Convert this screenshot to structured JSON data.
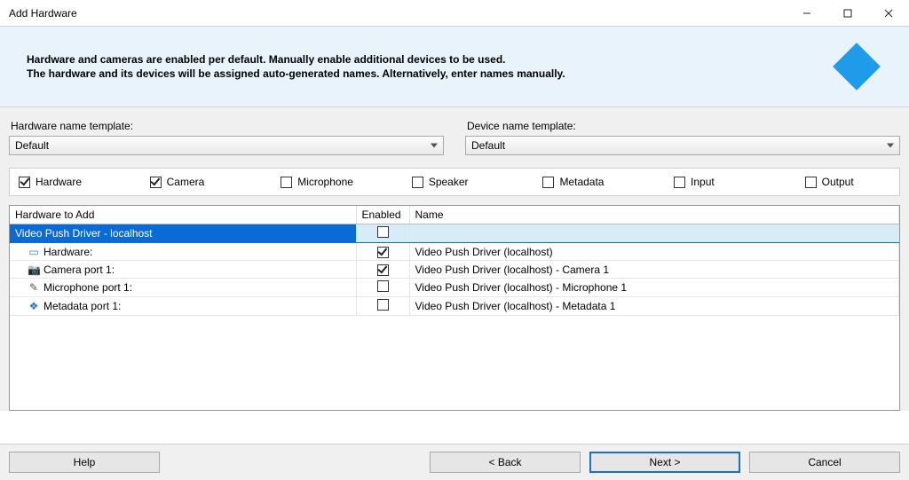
{
  "window": {
    "title": "Add Hardware"
  },
  "banner": {
    "line1": "Hardware and cameras are enabled per default. Manually enable additional devices to be used.",
    "line2": "The hardware and its devices will be assigned auto-generated names. Alternatively, enter names manually."
  },
  "templates": {
    "hardware_label": "Hardware name template:",
    "hardware_value": "Default",
    "device_label": "Device name template:",
    "device_value": "Default"
  },
  "filters": [
    {
      "label": "Hardware",
      "checked": true
    },
    {
      "label": "Camera",
      "checked": true
    },
    {
      "label": "Microphone",
      "checked": false
    },
    {
      "label": "Speaker",
      "checked": false
    },
    {
      "label": "Metadata",
      "checked": false
    },
    {
      "label": "Input",
      "checked": false
    },
    {
      "label": "Output",
      "checked": false
    }
  ],
  "table": {
    "headers": {
      "col1": "Hardware to Add",
      "col2": "Enabled",
      "col3": "Name"
    },
    "group_label": "Video Push Driver - localhost",
    "rows": [
      {
        "icon": "hw",
        "label": "Hardware:",
        "enabled": true,
        "name": "Video Push Driver (localhost)"
      },
      {
        "icon": "cam",
        "label": "Camera port 1:",
        "enabled": true,
        "name": "Video Push Driver (localhost) - Camera 1"
      },
      {
        "icon": "mic",
        "label": "Microphone port 1:",
        "enabled": false,
        "name": "Video Push Driver (localhost) - Microphone 1"
      },
      {
        "icon": "meta",
        "label": "Metadata port 1:",
        "enabled": false,
        "name": "Video Push Driver (localhost) - Metadata 1"
      }
    ]
  },
  "buttons": {
    "help": "Help",
    "back": "< Back",
    "next": "Next >",
    "cancel": "Cancel"
  },
  "icons": {
    "hw": "▭",
    "cam": "📷",
    "mic": "✎",
    "meta": "❖"
  }
}
